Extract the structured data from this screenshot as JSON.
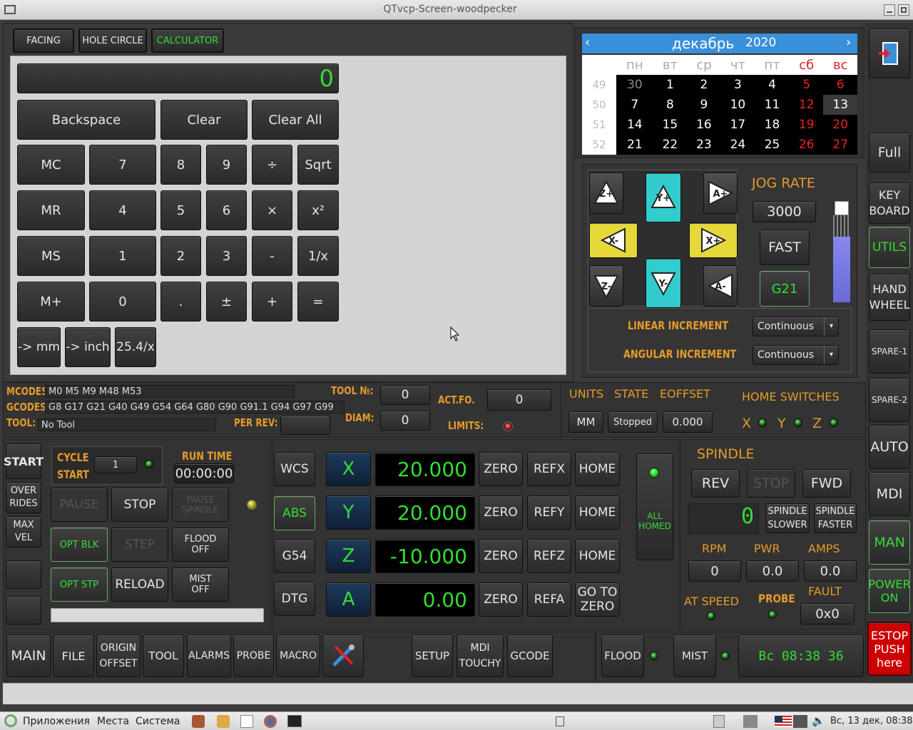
{
  "window": {
    "title": "QTvcp-Screen-woodpecker"
  },
  "tabs": [
    {
      "label": "FACING"
    },
    {
      "label": "HOLE CIRCLE"
    },
    {
      "label": "CALCULATOR"
    }
  ],
  "calculator": {
    "display": "0",
    "rows": [
      [
        "Backspace",
        "Clear",
        "Clear All"
      ],
      [
        "MC",
        "7",
        "8",
        "9",
        "÷",
        "Sqrt"
      ],
      [
        "MR",
        "4",
        "5",
        "6",
        "×",
        "x²"
      ],
      [
        "MS",
        "1",
        "2",
        "3",
        "-",
        "1/x"
      ],
      [
        "M+",
        "0",
        ".",
        "±",
        "+",
        "="
      ],
      [
        "-> mm",
        "-> inch",
        "25.4/x"
      ]
    ]
  },
  "calendar": {
    "month": "декабрь",
    "year": "2020",
    "weekdays": [
      "пн",
      "вт",
      "ср",
      "чт",
      "пт",
      "сб",
      "вс"
    ],
    "weeks": [
      {
        "num": "49",
        "days": [
          "30",
          "1",
          "2",
          "3",
          "4",
          "5",
          "6"
        ]
      },
      {
        "num": "50",
        "days": [
          "7",
          "8",
          "9",
          "10",
          "11",
          "12",
          "13"
        ]
      },
      {
        "num": "51",
        "days": [
          "14",
          "15",
          "16",
          "17",
          "18",
          "19",
          "20"
        ]
      },
      {
        "num": "52",
        "days": [
          "21",
          "22",
          "23",
          "24",
          "25",
          "26",
          "27"
        ]
      }
    ]
  },
  "jog": {
    "rate_label": "JOG RATE",
    "rate": "3000",
    "fast": "FAST",
    "g21": "G21",
    "linear_label": "LINEAR INCREMENT",
    "angular_label": "ANGULAR INCREMENT",
    "linear_value": "Continuous",
    "angular_value": "Continuous",
    "buttons": {
      "zplus": "Z+",
      "yplus": "Y+",
      "aplus": "A+",
      "xminus": "X-",
      "xplus": "X+",
      "zminus": "Z-",
      "yminus": "Y-",
      "aminus": "A-"
    }
  },
  "right_bar": {
    "full": "Full",
    "keyboard": "KEY\nBOARD",
    "utils": "UTILS",
    "handwheel": "HAND\nWHEEL",
    "spare1": "SPARE-1",
    "spare2": "SPARE-2",
    "auto": "AUTO",
    "mdi": "MDI",
    "man": "MAN",
    "power": "POWER\nON",
    "estop": "ESTOP\nPUSH\nhere"
  },
  "status": {
    "mcodes_label": "MCODES",
    "mcodes": "M0 M5 M9 M48 M53",
    "gcodes_label": "GCODES",
    "gcodes": "G8 G17 G21 G40 G49 G54 G64 G80 G90 G91.1 G94 G97 G99",
    "tool_label": "TOOL:",
    "tool": "No Tool",
    "toolno_label": "TOOL №:",
    "toolno": "0",
    "diam_label": "DIAM:",
    "diam": "0",
    "perrev_label": "PER REV:",
    "actfo_label": "ACT.FO.",
    "actfo": "0",
    "limits_label": "LIMITS:",
    "units_label": "UNITS",
    "state_label": "STATE",
    "eoffset_label": "EOFFSET",
    "units": "MM",
    "state": "Stopped",
    "eoffset": "0.000",
    "home_switches_label": "HOME SWITCHES",
    "hx": "X",
    "hy": "Y",
    "hz": "Z"
  },
  "run": {
    "start": "START",
    "overrides": "OVER\nRIDES",
    "maxvel": "MAX\nVEL",
    "cycle_start": "CYCLE\nSTART",
    "cycle_count": "1",
    "run_time_label": "RUN TIME",
    "run_time": "00:00:00",
    "pause": "PAUSE",
    "stop": "STOP",
    "pause_spindle": "PAUSE\nSPINDLE",
    "opt_blk": "OPT BLK",
    "step": "STEP",
    "flood_off": "FLOOD\nOFF",
    "opt_stp": "OPT STP",
    "reload": "RELOAD",
    "mist_off": "MIST\nOFF"
  },
  "dro": {
    "wcs": "WCS",
    "abs": "ABS",
    "g54": "G54",
    "dtg": "DTG",
    "zero": "ZERO",
    "home": "HOME",
    "goto_zero": "GO TO\nZERO",
    "all_homed": "ALL\nHOMED",
    "axes": [
      {
        "name": "X",
        "value": "20.000",
        "ref": "REFX"
      },
      {
        "name": "Y",
        "value": "20.000",
        "ref": "REFY"
      },
      {
        "name": "Z",
        "value": "-10.000",
        "ref": "REFZ"
      },
      {
        "name": "A",
        "value": "0.00",
        "ref": "REFA"
      }
    ]
  },
  "spindle": {
    "title": "SPINDLE",
    "rev": "REV",
    "stop": "STOP",
    "fwd": "FWD",
    "speed": "0",
    "slower": "SPINDLE\nSLOWER",
    "faster": "SPINDLE\nFASTER",
    "rpm_label": "RPM",
    "pwr_label": "PWR",
    "amps_label": "AMPS",
    "rpm": "0",
    "pwr": "0.0",
    "amps": "0.0",
    "at_speed": "AT SPEED",
    "probe": "PROBE",
    "fault_label": "FAULT",
    "fault": "0x0"
  },
  "bottom": {
    "main": "MAIN",
    "file": "FILE",
    "origin": "ORIGIN\nOFFSET",
    "tool": "TOOL",
    "alarms": "ALARMS",
    "probe": "PROBE",
    "macro": "MACRO",
    "setup": "SETUP",
    "mdi_touchy": "MDI\nTOUCHY",
    "gcode": "GCODE",
    "flood": "FLOOD",
    "mist": "MIST",
    "clock": "Вс 08:38 36"
  },
  "taskbar": {
    "apps": "Приложения",
    "places": "Места",
    "system": "Система",
    "datetime": "Вс, 13 дек, 08:38"
  }
}
